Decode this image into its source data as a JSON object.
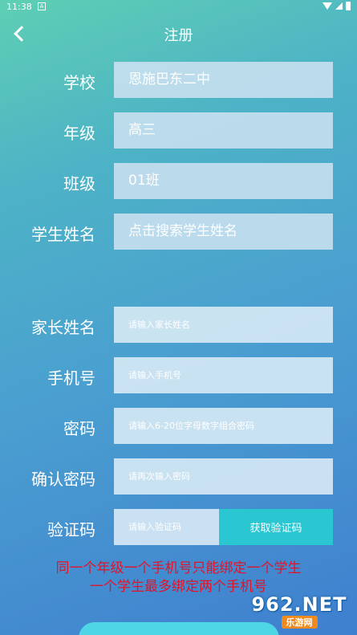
{
  "status_bar": {
    "time": "11:38",
    "badge": "A"
  },
  "header": {
    "title": "注册"
  },
  "form": {
    "school": {
      "label": "学校",
      "value": "恩施巴东二中"
    },
    "grade": {
      "label": "年级",
      "value": "高三"
    },
    "class": {
      "label": "班级",
      "value": "01班"
    },
    "student_name": {
      "label": "学生姓名",
      "placeholder": "点击搜索学生姓名"
    },
    "parent_name": {
      "label": "家长姓名",
      "placeholder": "请输入家长姓名"
    },
    "phone": {
      "label": "手机号",
      "placeholder": "请输入手机号"
    },
    "password": {
      "label": "密码",
      "placeholder": "请输入6-20位字母数字组合密码"
    },
    "confirm_password": {
      "label": "确认密码",
      "placeholder": "请再次输入密码"
    },
    "verification": {
      "label": "验证码",
      "placeholder": "请输入验证码",
      "button": "获取验证码"
    }
  },
  "notice": {
    "line1": "同一个年级一个手机号只能绑定一个学生",
    "line2": "一个学生最多绑定两个手机号"
  },
  "watermark": {
    "main": "962.NET",
    "sub": "乐游网"
  },
  "colors": {
    "accent": "#2ac6d2",
    "warning": "#e0142a"
  }
}
